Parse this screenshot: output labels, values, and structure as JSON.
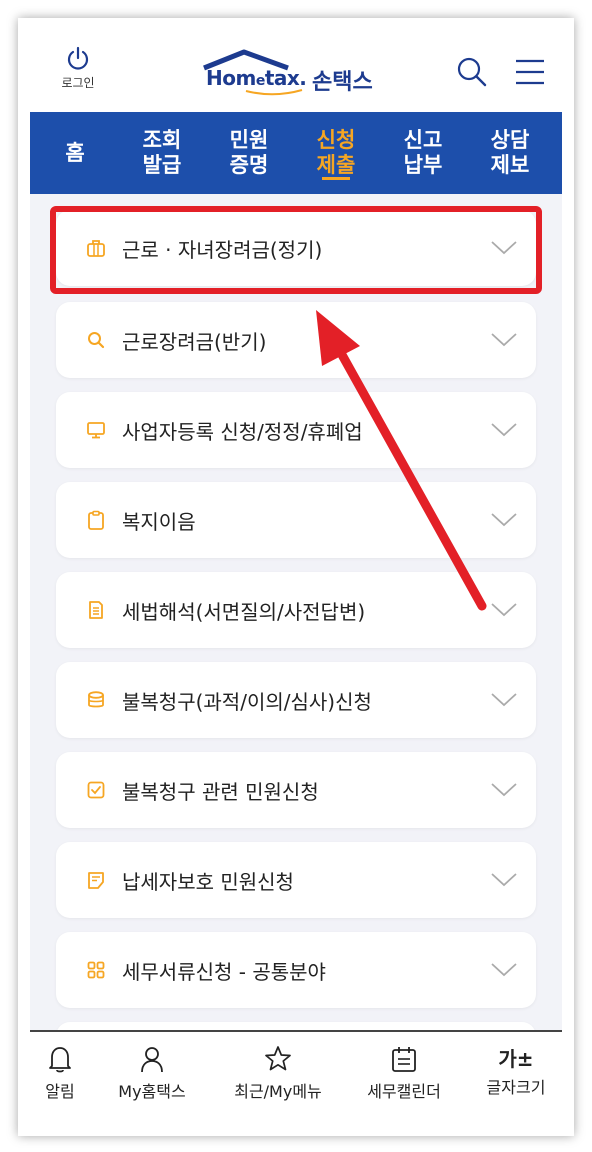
{
  "header": {
    "login_label": "로그인",
    "logo_text_1": "Hom",
    "logo_text_small": "e",
    "logo_text_2": "tax.",
    "logo_korean": "손택스",
    "icons": [
      "power-icon",
      "search-icon",
      "hamburger-menu-icon"
    ]
  },
  "nav": {
    "items": [
      {
        "label": "홈"
      },
      {
        "label": "조회\n발급"
      },
      {
        "label": "민원\n증명"
      },
      {
        "label": "신청\n제출",
        "active": true
      },
      {
        "label": "신고\n납부"
      },
      {
        "label": "상담\n제보"
      }
    ]
  },
  "list": {
    "items": [
      {
        "label": "근로 · 자녀장려금(정기)",
        "icon": "briefcase-icon"
      },
      {
        "label": "근로장려금(반기)",
        "icon": "search-icon"
      },
      {
        "label": "사업자등록 신청/정정/휴폐업",
        "icon": "monitor-icon"
      },
      {
        "label": "복지이음",
        "icon": "clipboard-icon"
      },
      {
        "label": "세법해석(서면질의/사전답변)",
        "icon": "document-icon"
      },
      {
        "label": "불복청구(과적/이의/심사)신청",
        "icon": "database-icon"
      },
      {
        "label": "불복청구 관련 민원신청",
        "icon": "checkbox-icon"
      },
      {
        "label": "납세자보호 민원신청",
        "icon": "note-icon"
      },
      {
        "label": "세무서류신청 - 공통분야",
        "icon": "grid-icon"
      }
    ]
  },
  "bottom_nav": {
    "items": [
      {
        "label": "알림",
        "icon": "bell-icon"
      },
      {
        "label": "My홈택스",
        "icon": "person-icon"
      },
      {
        "label": "최근/My메뉴",
        "icon": "star-icon"
      },
      {
        "label": "세무캘린더",
        "icon": "calendar-icon"
      },
      {
        "label": "글자크기",
        "icon": "font-size-icon",
        "glyph": "가±"
      }
    ]
  },
  "colors": {
    "brand_blue": "#1d4fab",
    "active_orange": "#f6a623",
    "highlight_red": "#e32027",
    "background": "#f2f3f8"
  }
}
